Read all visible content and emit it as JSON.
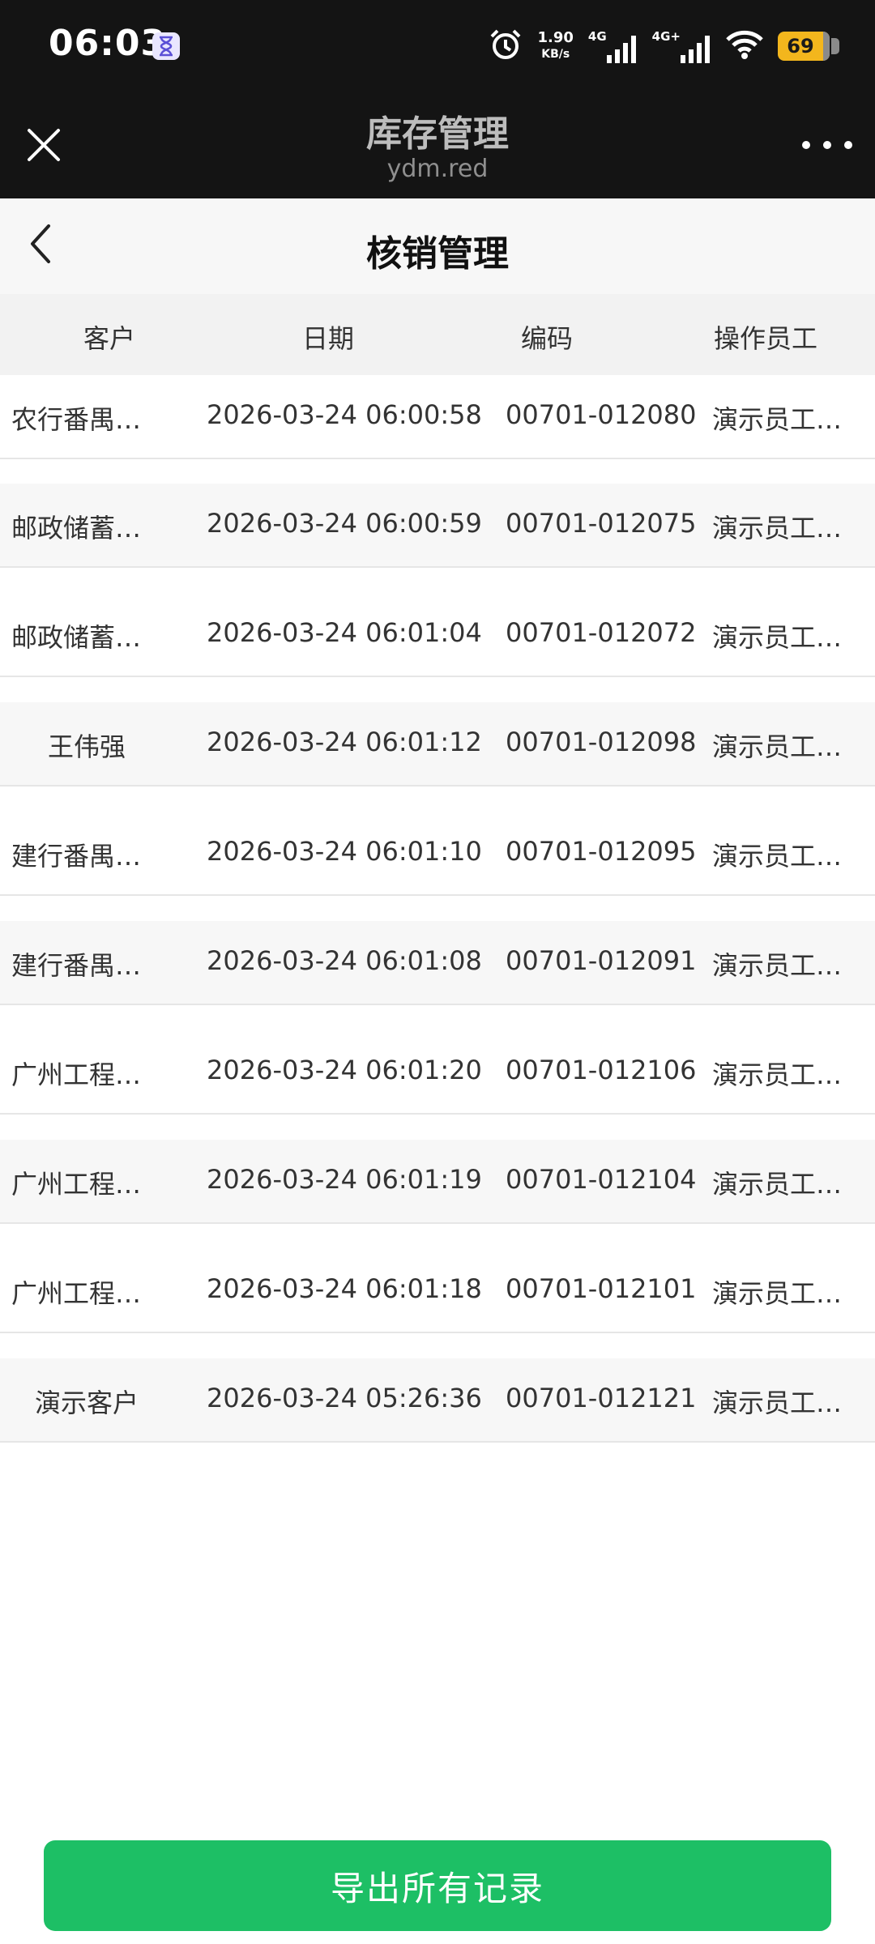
{
  "status_bar": {
    "time": "06:03",
    "speed_value": "1.90",
    "speed_unit": "KB/s",
    "net1": "4G",
    "net2": "4G+",
    "battery": "69",
    "icons": [
      "hourglass-icon",
      "alarm-icon",
      "signal-icon",
      "wifi-icon",
      "battery-icon"
    ]
  },
  "app_bar": {
    "title": "库存管理",
    "subtitle": "ydm.red"
  },
  "page": {
    "title": "核销管理"
  },
  "table": {
    "headers": [
      "客户",
      "日期",
      "编码",
      "操作员工"
    ],
    "rows": [
      {
        "customer": "农行番禺…",
        "date": "2026-03-24 06:00:58",
        "code": "00701-012080",
        "operator": "演示员工…"
      },
      {
        "customer": "邮政储蓄…",
        "date": "2026-03-24 06:00:59",
        "code": "00701-012075",
        "operator": "演示员工…"
      },
      {
        "customer": "邮政储蓄…",
        "date": "2026-03-24 06:01:04",
        "code": "00701-012072",
        "operator": "演示员工…"
      },
      {
        "customer": "王伟强",
        "date": "2026-03-24 06:01:12",
        "code": "00701-012098",
        "operator": "演示员工…"
      },
      {
        "customer": "建行番禺…",
        "date": "2026-03-24 06:01:10",
        "code": "00701-012095",
        "operator": "演示员工…"
      },
      {
        "customer": "建行番禺…",
        "date": "2026-03-24 06:01:08",
        "code": "00701-012091",
        "operator": "演示员工…"
      },
      {
        "customer": "广州工程…",
        "date": "2026-03-24 06:01:20",
        "code": "00701-012106",
        "operator": "演示员工…"
      },
      {
        "customer": "广州工程…",
        "date": "2026-03-24 06:01:19",
        "code": "00701-012104",
        "operator": "演示员工…"
      },
      {
        "customer": "广州工程…",
        "date": "2026-03-24 06:01:18",
        "code": "00701-012101",
        "operator": "演示员工…"
      },
      {
        "customer": "演示客户",
        "date": "2026-03-24 05:26:36",
        "code": "00701-012121",
        "operator": "演示员工…"
      }
    ]
  },
  "footer": {
    "export_label": "导出所有记录"
  },
  "colors": {
    "top_bar": "#141414",
    "accent_green": "#1dbf65",
    "battery": "#f3b61d"
  }
}
